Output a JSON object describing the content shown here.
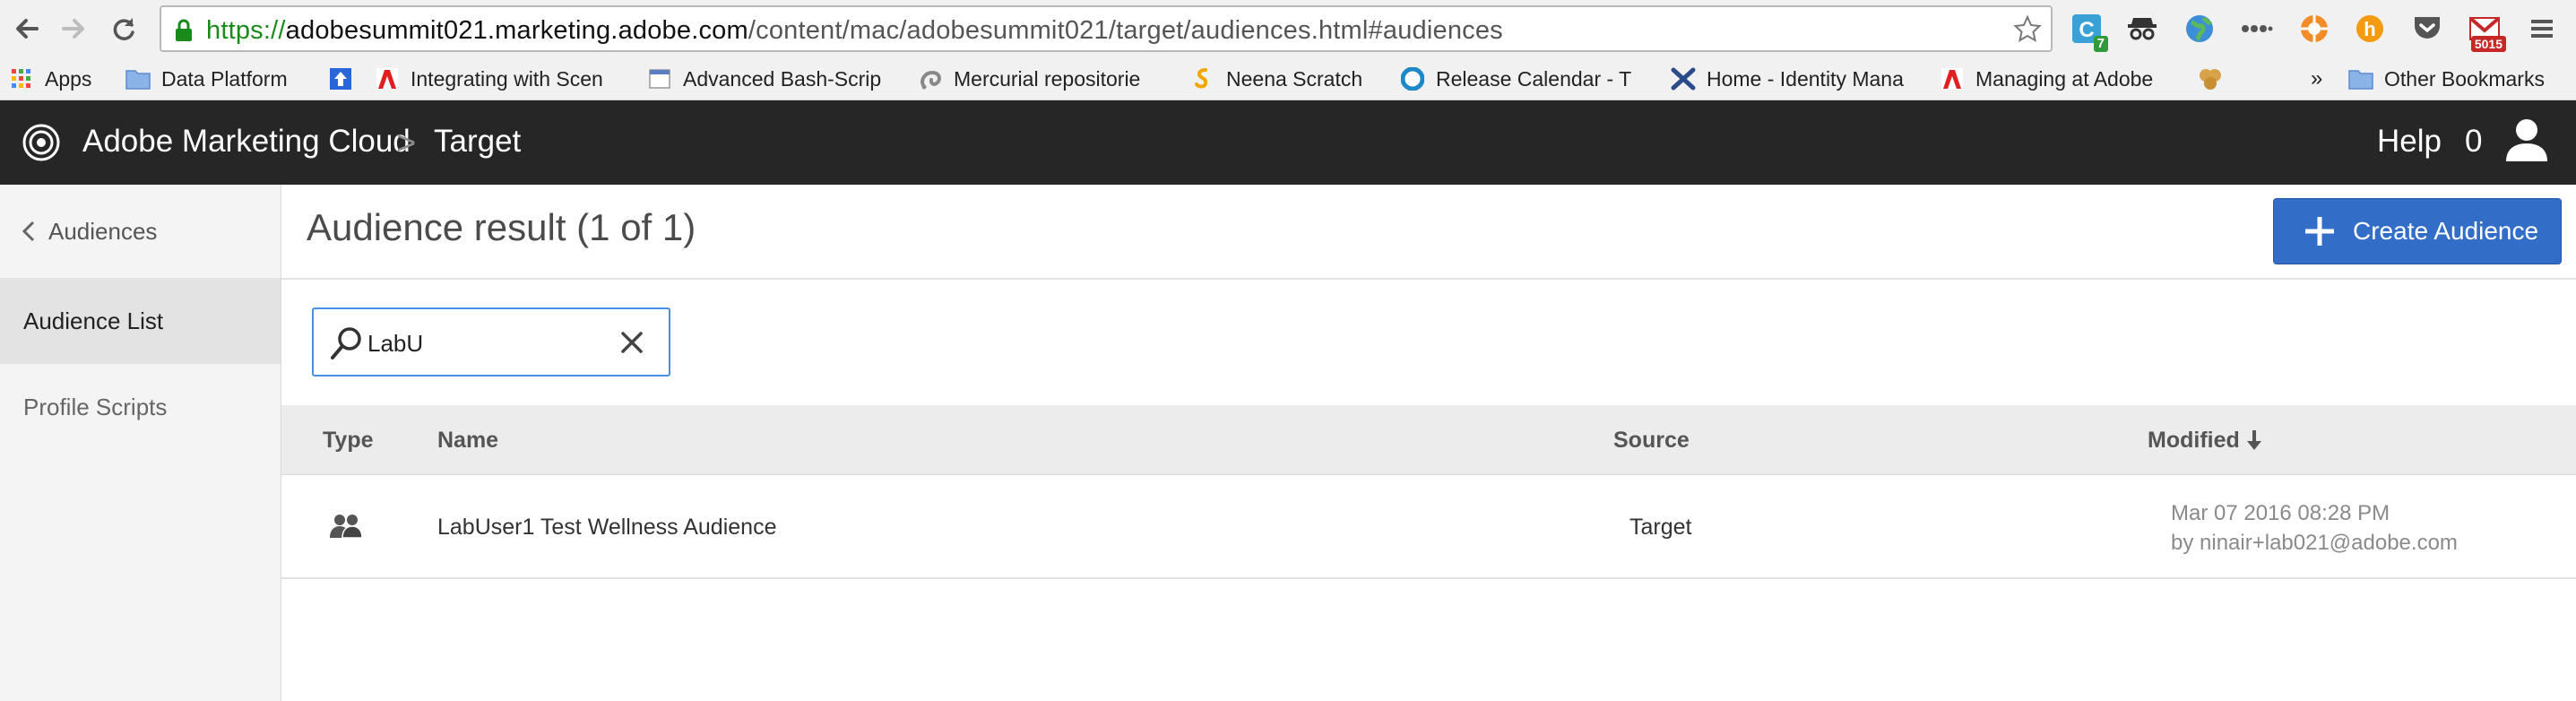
{
  "browser": {
    "url_scheme": "https://",
    "url_host": "adobesummit021.marketing.adobe.com",
    "url_path": "/content/mac/adobesummit021/target/audiences.html#audiences",
    "extensions": [
      {
        "icon": "c-badge-extension-icon",
        "badge": "7"
      },
      {
        "icon": "incognito-mask-icon"
      },
      {
        "icon": "globe-icon"
      },
      {
        "icon": "ellipsis-icon"
      },
      {
        "icon": "lifebuoy-icon"
      },
      {
        "icon": "honey-h-icon"
      },
      {
        "icon": "pocket-icon"
      },
      {
        "icon": "gmail-icon",
        "badge": "5015"
      },
      {
        "icon": "chrome-menu-icon"
      }
    ],
    "bookmarks": [
      {
        "label": "Apps",
        "icon": "apps-grid-icon"
      },
      {
        "label": "Data Platform",
        "icon": "folder-icon"
      },
      {
        "label": "",
        "icon": "upload-arrow-icon"
      },
      {
        "label": "Integrating with Scen",
        "icon": "adobe-icon"
      },
      {
        "label": "Advanced Bash-Scrip",
        "icon": "document-icon"
      },
      {
        "label": "Mercurial repositorie",
        "icon": "mercurial-icon"
      },
      {
        "label": "Neena Scratch",
        "icon": "scratch-icon"
      },
      {
        "label": "Release Calendar - T",
        "icon": "release-circle-icon"
      },
      {
        "label": "Home - Identity Mana",
        "icon": "confluence-x-icon"
      },
      {
        "label": "Managing at Adobe",
        "icon": "adobe-icon"
      },
      {
        "label": "",
        "icon": "cookie-icon"
      },
      {
        "label": "»",
        "icon": ""
      },
      {
        "label": "Other Bookmarks",
        "icon": "folder-icon"
      }
    ]
  },
  "header": {
    "brand": "Adobe Marketing Cloud",
    "crumb_separator": ">",
    "product": "Target",
    "help": "Help",
    "notifications": "0"
  },
  "sidebar": {
    "back_label": "Audiences",
    "items": [
      {
        "label": "Audience List",
        "active": true
      },
      {
        "label": "Profile Scripts",
        "active": false
      }
    ]
  },
  "main": {
    "title": "Audience result (1 of 1)",
    "create_button": "Create Audience",
    "search": {
      "value": "LabU",
      "placeholder": ""
    },
    "table": {
      "columns": [
        "Type",
        "Name",
        "Source",
        "Modified"
      ],
      "sort_column": "Modified",
      "sort_direction": "descending",
      "rows": [
        {
          "type_icon": "audience-group-icon",
          "name": "LabUser1 Test Wellness Audience",
          "source": "Target",
          "modified_date": "Mar 07 2016 08:28 PM",
          "modified_by": "by ninair+lab021@adobe.com"
        }
      ]
    }
  },
  "colors": {
    "header_bg": "#262626",
    "primary_button": "#326ec8",
    "search_focus": "#4a90e2",
    "url_secure": "#1a8a1a"
  }
}
